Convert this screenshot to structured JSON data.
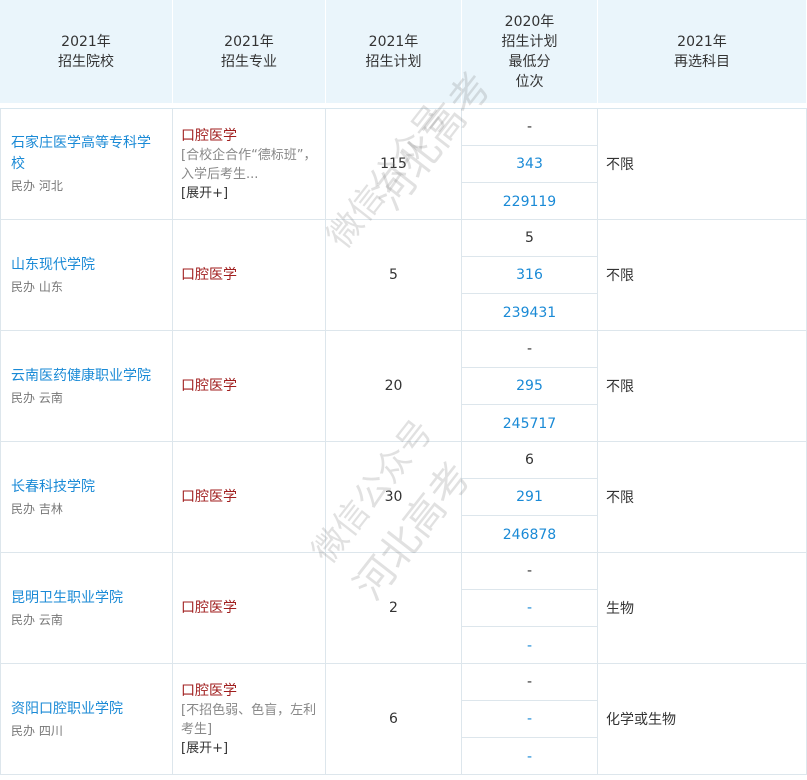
{
  "header": {
    "col1": {
      "line1": "2021年",
      "line2": "招生院校"
    },
    "col2": {
      "line1": "2021年",
      "line2": "招生专业"
    },
    "col3": {
      "line1": "2021年",
      "line2": "招生计划"
    },
    "col4": {
      "line1": "2020年",
      "line2": "招生计划",
      "line3": "最低分",
      "line4": "位次"
    },
    "col5": {
      "line1": "2021年",
      "line2": "再选科目"
    }
  },
  "rows": [
    {
      "school": "石家庄医学高等专科学校",
      "type": "民办",
      "province": "河北",
      "major": "口腔医学",
      "note": "[合校企合作“德标班”，入学后考生...",
      "expand": "[展开+]",
      "plan2021": "115",
      "plan2020": "-",
      "min_score": "343",
      "rank": "229119",
      "elective": "不限"
    },
    {
      "school": "山东现代学院",
      "type": "民办",
      "province": "山东",
      "major": "口腔医学",
      "note": "",
      "expand": "",
      "plan2021": "5",
      "plan2020": "5",
      "min_score": "316",
      "rank": "239431",
      "elective": "不限"
    },
    {
      "school": "云南医药健康职业学院",
      "type": "民办",
      "province": "云南",
      "major": "口腔医学",
      "note": "",
      "expand": "",
      "plan2021": "20",
      "plan2020": "-",
      "min_score": "295",
      "rank": "245717",
      "elective": "不限"
    },
    {
      "school": "长春科技学院",
      "type": "民办",
      "province": "吉林",
      "major": "口腔医学",
      "note": "",
      "expand": "",
      "plan2021": "30",
      "plan2020": "6",
      "min_score": "291",
      "rank": "246878",
      "elective": "不限"
    },
    {
      "school": "昆明卫生职业学院",
      "type": "民办",
      "province": "云南",
      "major": "口腔医学",
      "note": "",
      "expand": "",
      "plan2021": "2",
      "plan2020": "-",
      "min_score": "-",
      "rank": "-",
      "elective": "生物"
    },
    {
      "school": "资阳口腔职业学院",
      "type": "民办",
      "province": "四川",
      "major": "口腔医学",
      "note": "[不招色弱、色盲，左利考生]",
      "expand": "[展开+]",
      "plan2021": "6",
      "plan2020": "-",
      "min_score": "-",
      "rank": "-",
      "elective": "化学或生物"
    }
  ],
  "watermark": {
    "line1": "微信公众号",
    "line2": "河北高考"
  }
}
